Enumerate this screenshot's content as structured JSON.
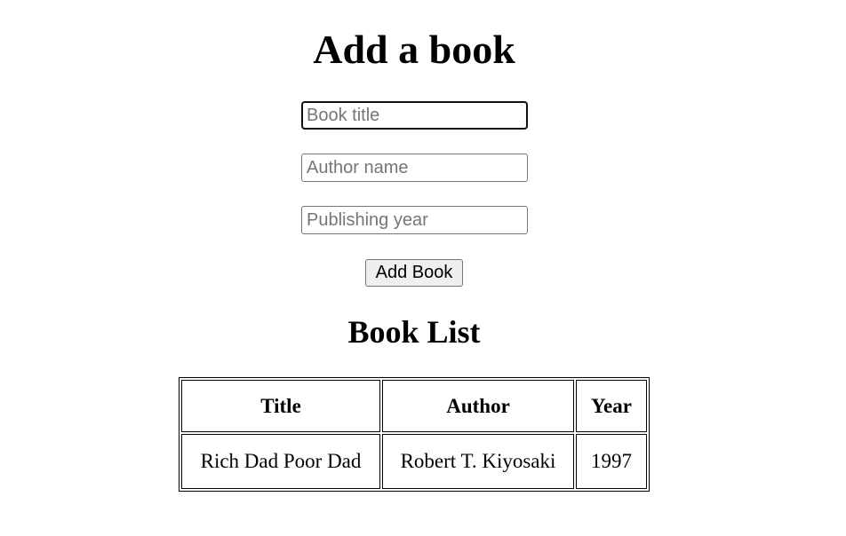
{
  "form": {
    "heading": "Add a book",
    "title_placeholder": "Book title",
    "author_placeholder": "Author name",
    "year_placeholder": "Publishing year",
    "submit_label": "Add Book"
  },
  "list": {
    "heading": "Book List",
    "columns": [
      "Title",
      "Author",
      "Year"
    ],
    "rows": [
      [
        "Rich Dad Poor Dad",
        "Robert T. Kiyosaki",
        "1997"
      ]
    ]
  }
}
